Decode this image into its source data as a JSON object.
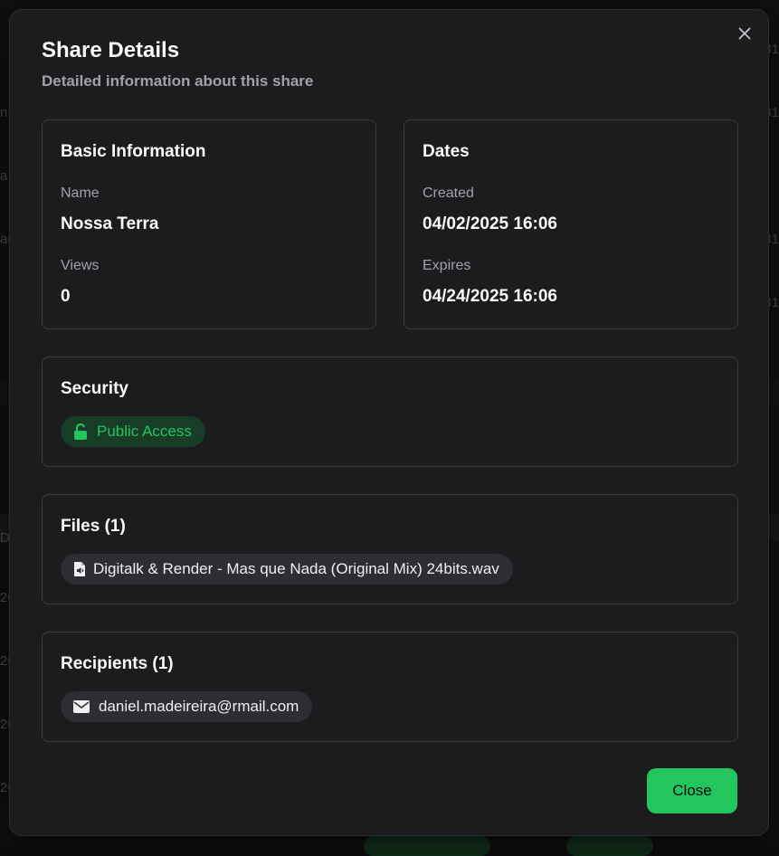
{
  "background": {
    "left_fragments": [
      "n-",
      "a",
      "ac",
      "D",
      "20",
      "20",
      "20",
      "20"
    ],
    "right_fragments": [
      "31",
      "31",
      "31",
      "31"
    ]
  },
  "modal": {
    "title": "Share Details",
    "subtitle": "Detailed information about this share",
    "close_icon": "close-icon",
    "basic_info": {
      "title": "Basic Information",
      "name_label": "Name",
      "name_value": "Nossa Terra",
      "views_label": "Views",
      "views_value": "0"
    },
    "dates": {
      "title": "Dates",
      "created_label": "Created",
      "created_value": "04/02/2025 16:06",
      "expires_label": "Expires",
      "expires_value": "04/24/2025 16:06"
    },
    "security": {
      "title": "Security",
      "badge_label": "Public Access",
      "badge_icon": "unlock-icon",
      "badge_color": "#22c55e"
    },
    "files": {
      "title": "Files (1)",
      "items": [
        {
          "name": "Digitalk & Render - Mas que Nada (Original Mix) 24bits.wav",
          "icon": "audio-file-icon"
        }
      ]
    },
    "recipients": {
      "title": "Recipients (1)",
      "items": [
        {
          "email": "daniel.madeireira@rmail.com",
          "icon": "mail-icon"
        }
      ]
    },
    "close_button_label": "Close",
    "accent_color": "#22c55e"
  }
}
